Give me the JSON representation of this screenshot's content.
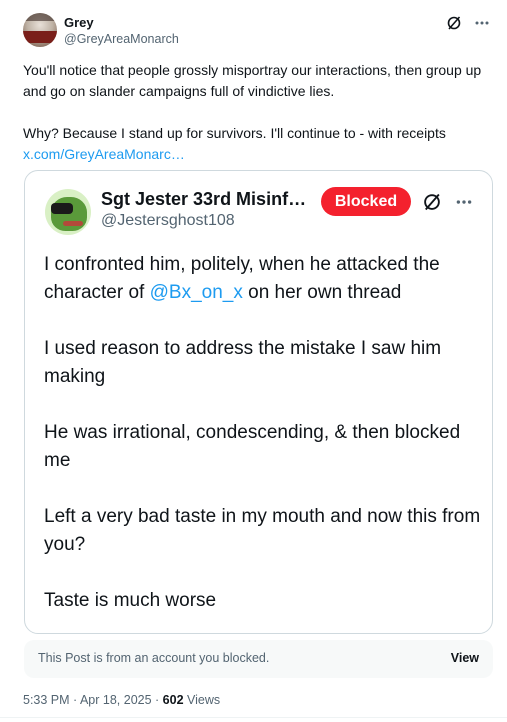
{
  "post": {
    "author_name": "Grey",
    "author_handle": "@GreyAreaMonarch",
    "paragraph_1": "You'll notice that people grossly misportray our interactions, then group up and go on slander campaigns full of vindictive lies.",
    "paragraph_2": "Why? Because I stand up for survivors. I'll continue to - with receipts",
    "link_text": "x.com/GreyAreaMonarc…"
  },
  "icons": {
    "grok": "slash-circle-icon",
    "more": "more-horizontal-icon"
  },
  "quote": {
    "author_name": "Sgt Jester 33rd Misinfor…",
    "author_handle": "@Jestersghost108",
    "blocked_label": "Blocked",
    "p1_before": "I confronted him, politely, when he attacked the character of ",
    "p1_mention": "@Bx_on_x",
    "p1_after": " on her own thread",
    "p2": "I used reason to address the mistake I saw him making",
    "p3": "He was irrational, condescending, & then blocked me",
    "p4": "Left a very bad taste in my mouth and now this from you?",
    "p5": "Taste is much worse"
  },
  "notice": {
    "message": "This Post is from an account you blocked.",
    "view_label": "View"
  },
  "meta": {
    "timestamp": "5:33 PM · Apr 18, 2025 · ",
    "views_count": "602",
    "views_label": " Views"
  },
  "colors": {
    "accent": "#1d9bf0",
    "blocked_badge": "#f4212e",
    "muted_text": "#536471"
  }
}
